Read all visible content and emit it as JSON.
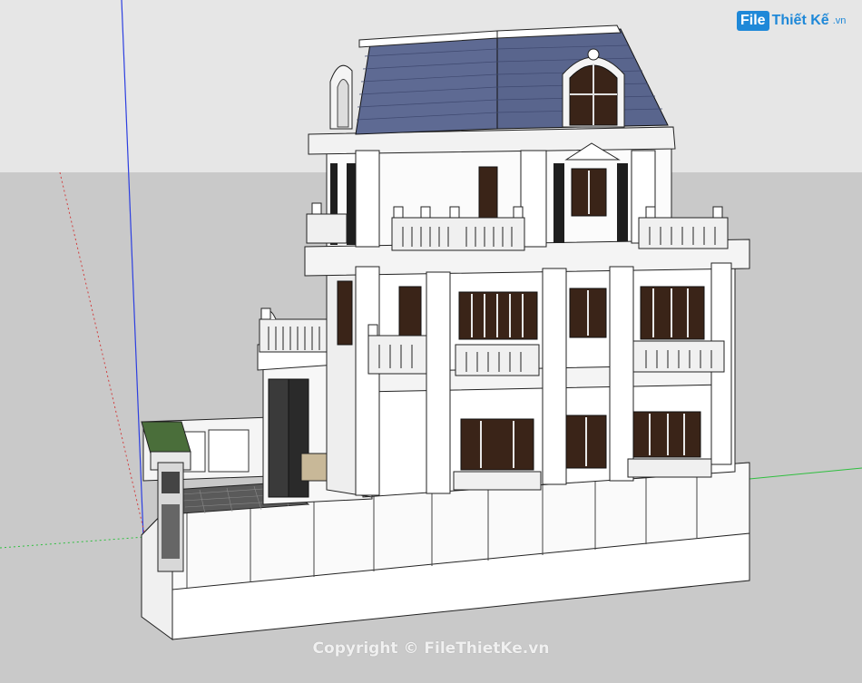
{
  "watermark": {
    "badge": "File",
    "name": "Thiết Kế",
    "tld": ".vn",
    "copyright": "Copyright © FileThietKe.vn"
  },
  "scene": {
    "sky_color": "#e6e6e6",
    "ground_color": "#c9c9c9",
    "roof_color": "#5e6a93",
    "wall_color": "#f5f5f5",
    "window_color": "#3a2418",
    "axis_blue": "#2d3fe0",
    "axis_green": "#2fbf3f",
    "axis_red": "#d04040"
  }
}
